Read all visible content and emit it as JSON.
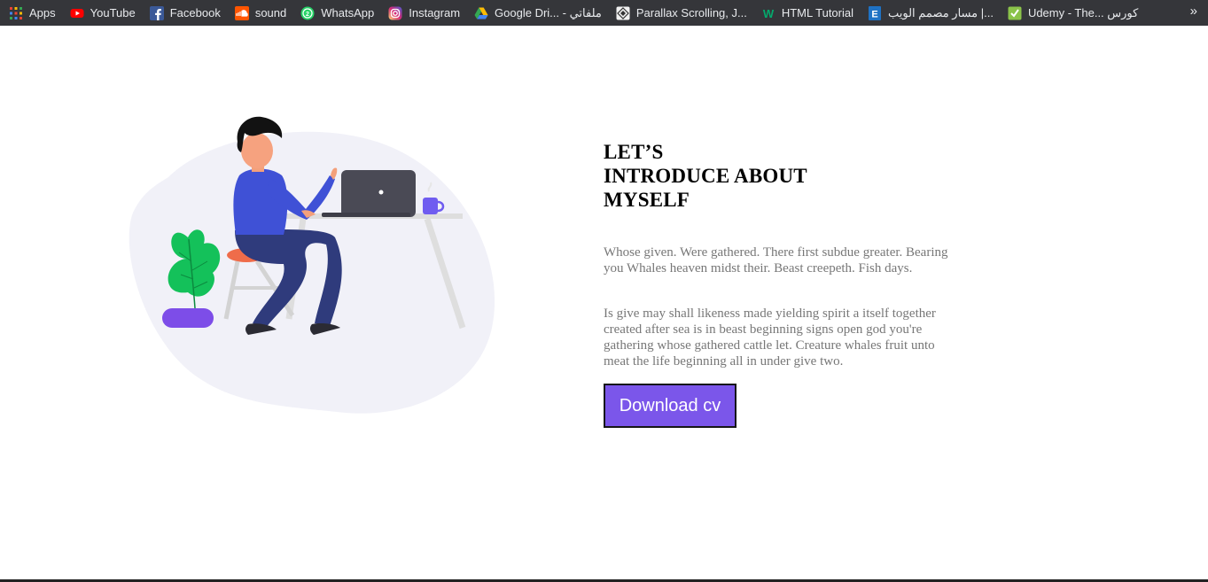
{
  "bookmarks": [
    {
      "label": "Apps",
      "icon": "apps-grid-icon"
    },
    {
      "label": "YouTube",
      "icon": "youtube-icon"
    },
    {
      "label": "Facebook",
      "icon": "facebook-icon"
    },
    {
      "label": "sound",
      "icon": "soundcloud-icon"
    },
    {
      "label": "WhatsApp",
      "icon": "whatsapp-icon"
    },
    {
      "label": "Instagram",
      "icon": "instagram-icon"
    },
    {
      "label": "Google Dri... - ملفاتي",
      "icon": "google-drive-icon"
    },
    {
      "label": "Parallax Scrolling, J...",
      "icon": "parallax-icon"
    },
    {
      "label": "HTML Tutorial",
      "icon": "w3schools-icon"
    },
    {
      "label": "مسار مصمم الويب |...",
      "icon": "e-icon"
    },
    {
      "label": "Udemy - The... كورس",
      "icon": "udemy-icon"
    }
  ],
  "overflow_label": "»",
  "about": {
    "heading_lines": [
      "LET’S",
      "INTRODUCE ABOUT",
      "MYSELF"
    ],
    "paragraph_1": "Whose given. Were gathered. There first subdue greater. Bearing you Whales heaven midst their. Beast creepeth. Fish days.",
    "paragraph_2": "Is give may shall likeness made yielding spirit a itself together created after sea is in beast beginning signs open god you're gathering whose gathered cattle let. Creature whales fruit unto meat the life beginning all in under give two.",
    "button_label": "Download cv"
  },
  "colors": {
    "accent": "#7b56ea",
    "bookmarks_bg": "#35363a"
  }
}
